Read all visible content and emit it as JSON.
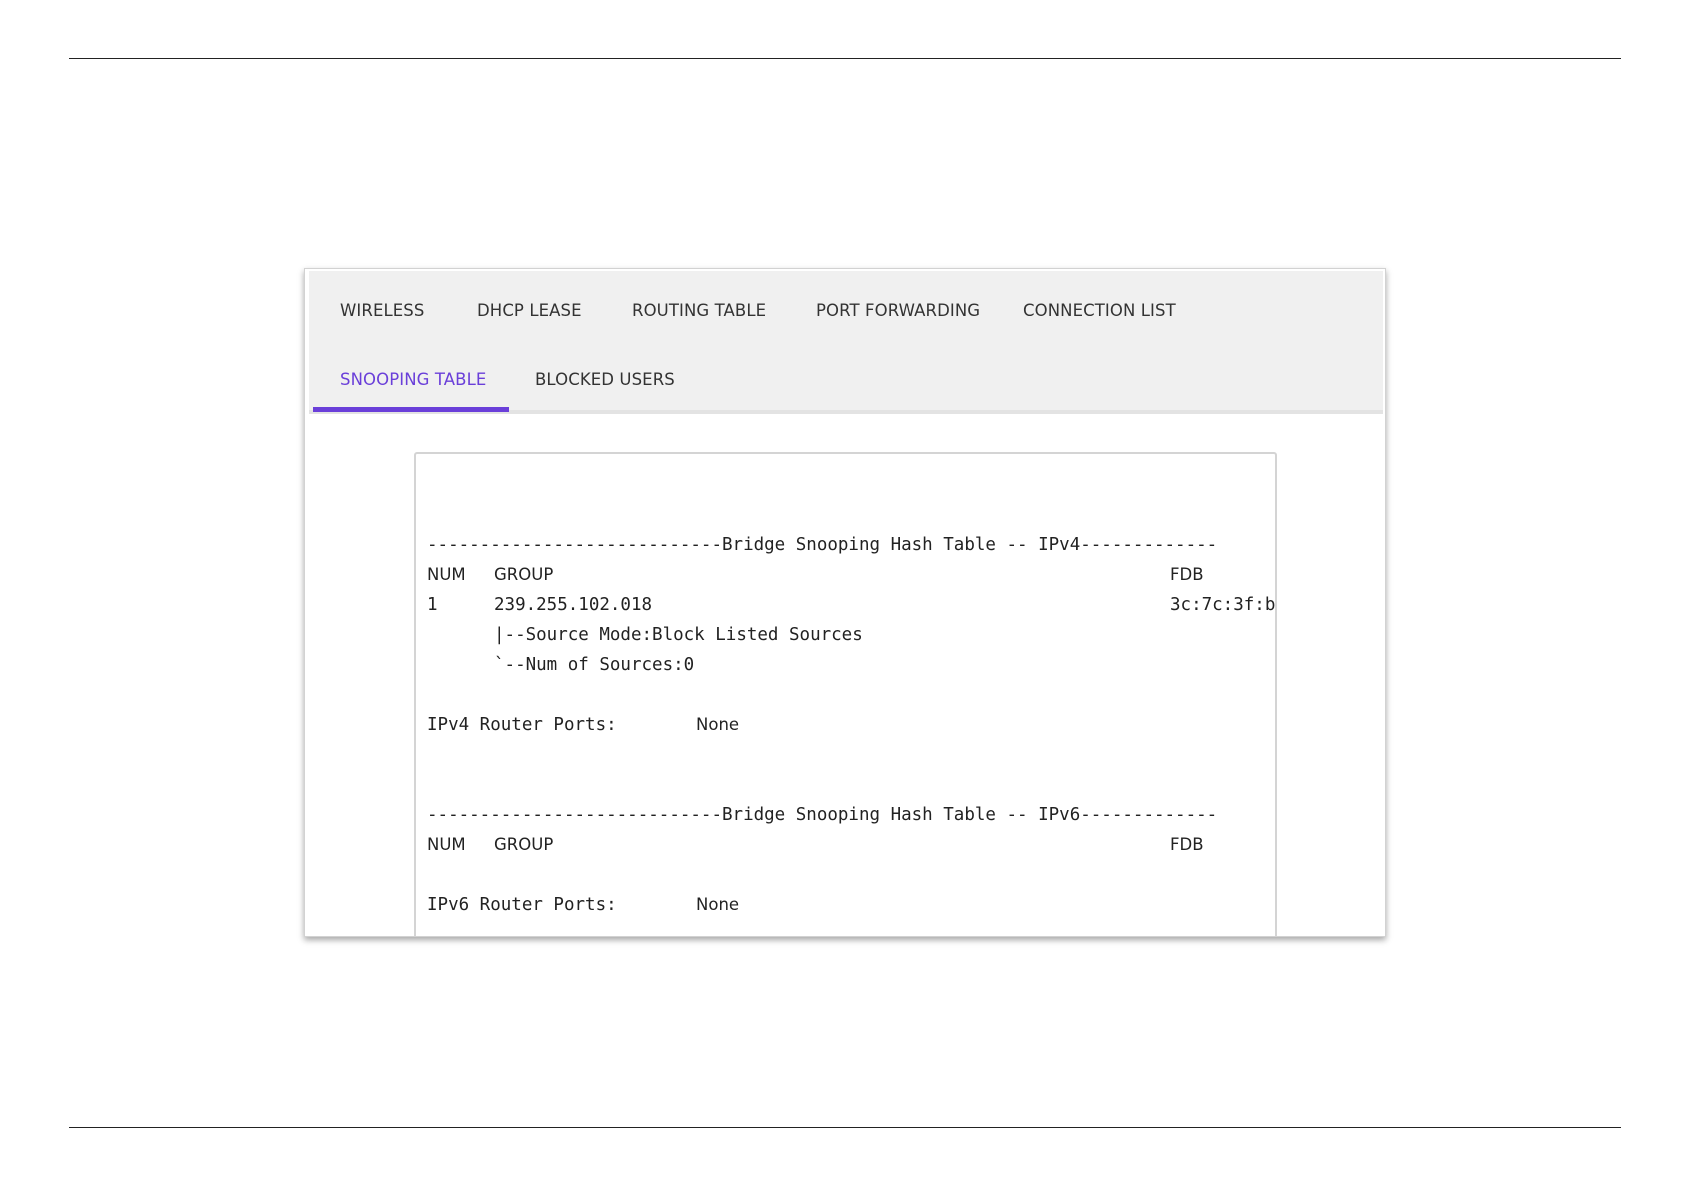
{
  "tabs": {
    "wireless": "WIRELESS",
    "dhcp_lease": "DHCP LEASE",
    "routing_table": "ROUTING TABLE",
    "port_forwarding": "PORT FORWARDING",
    "connection_list": "CONNECTION LIST",
    "snooping_table": "SNOOPING TABLE",
    "blocked_users": "BLOCKED USERS",
    "active_tab": "SNOOPING TABLE",
    "accent_color": "#6a3fd9"
  },
  "console": {
    "ipv4_header": "----------------------------Bridge Snooping Hash Table -- IPv4-------------",
    "ipv4_col_num": "NUM",
    "ipv4_col_group": "GROUP",
    "ipv4_col_fdb": "FDB",
    "row1_num": "1",
    "row1_group": "239.255.102.018",
    "row1_fdb": "3c:7c:3f:b",
    "row1_source_mode": "|--Source Mode:Block Listed Sources",
    "row1_num_sources": "`--Num of Sources:0",
    "ipv4_router_ports_label": "IPv4 Router Ports:",
    "ipv4_router_ports_value": "None",
    "ipv6_header": "----------------------------Bridge Snooping Hash Table -- IPv6-------------",
    "ipv6_col_num": "NUM",
    "ipv6_col_group": "GROUP",
    "ipv6_col_fdb": "FDB",
    "ipv6_router_ports_label": "IPv6 Router Ports:",
    "ipv6_router_ports_value": "None"
  }
}
